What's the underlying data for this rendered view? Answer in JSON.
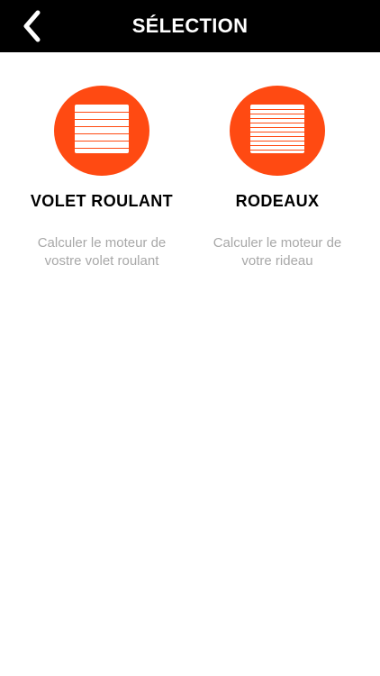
{
  "header": {
    "title": "SÉLECTION",
    "back_icon": "chevron-left-icon"
  },
  "colors": {
    "accent": "#ff4a12",
    "header_bg": "#000000",
    "description_text": "#a8a8a8"
  },
  "options": [
    {
      "icon": "roller-shutter-icon",
      "title": "VOLET ROULANT",
      "description_line1": "Calculer le moteur de",
      "description_line2": "vostre volet roulant"
    },
    {
      "icon": "curtain-blind-icon",
      "title": "RODEAUX",
      "description_line1": "Calculer le moteur de",
      "description_line2": "votre rideau"
    }
  ]
}
